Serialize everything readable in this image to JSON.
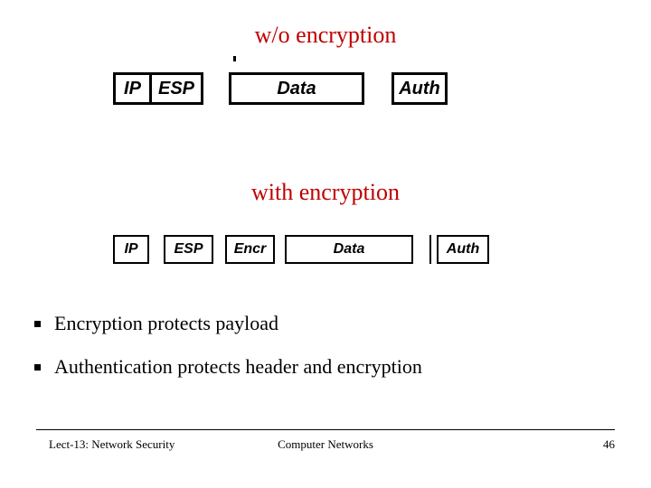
{
  "headings": {
    "without": "w/o encryption",
    "with": "with encryption"
  },
  "chart_data": [
    {
      "type": "table",
      "title": "w/o encryption",
      "fields": [
        "IP",
        "ESP",
        "Data",
        "Auth"
      ]
    },
    {
      "type": "table",
      "title": "with encryption",
      "fields": [
        "IP",
        "ESP",
        "Encr",
        "Data",
        "Auth"
      ]
    }
  ],
  "bullets": [
    "Encryption protects payload",
    "Authentication protects header and encryption"
  ],
  "footer": {
    "left": "Lect-13: Network Security",
    "center": "Computer Networks",
    "right": "46"
  }
}
